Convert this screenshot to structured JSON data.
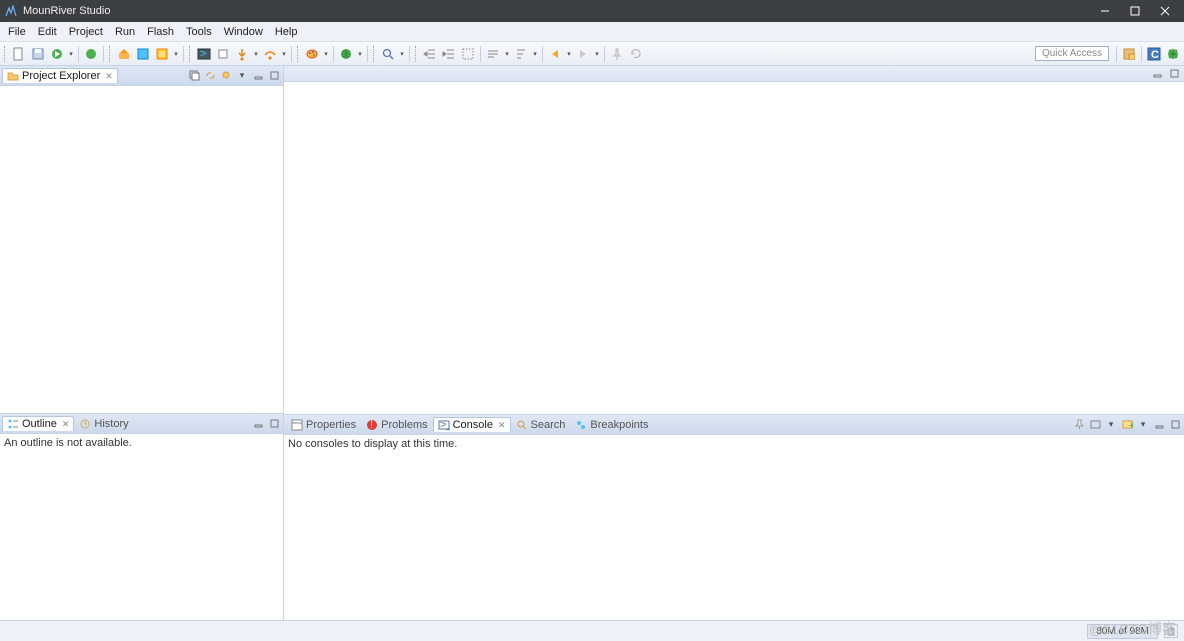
{
  "window": {
    "title": "MounRiver Studio"
  },
  "menu": [
    "File",
    "Edit",
    "Project",
    "Run",
    "Flash",
    "Tools",
    "Window",
    "Help"
  ],
  "toolbar": {
    "quick_access": "Quick Access"
  },
  "left": {
    "explorer": {
      "title": "Project Explorer"
    },
    "outline": {
      "title": "Outline",
      "history": "History",
      "empty": "An outline is not available."
    }
  },
  "bottom": {
    "tabs": {
      "properties": "Properties",
      "problems": "Problems",
      "console": "Console",
      "search": "Search",
      "breakpoints": "Breakpoints"
    },
    "console_empty": "No consoles to display at this time."
  },
  "status": {
    "heap": "80M of 98M"
  },
  "watermark": "@51CTO博客"
}
